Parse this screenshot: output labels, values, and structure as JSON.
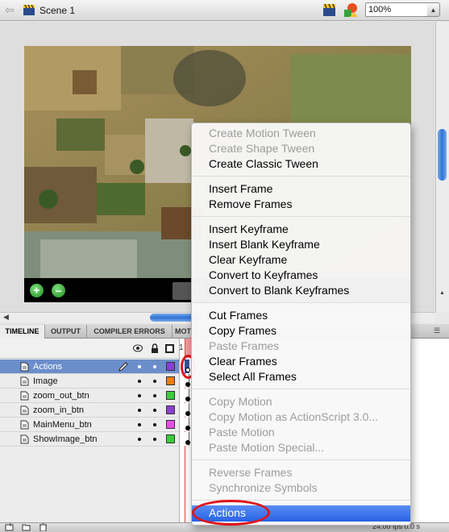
{
  "toolbar": {
    "scene_label": "Scene 1",
    "zoom_value": "100%"
  },
  "timeline": {
    "tabs": [
      "TIMELINE",
      "OUTPUT",
      "COMPILER ERRORS",
      "MOT"
    ],
    "frame_number": "1",
    "layers": [
      {
        "name": "Actions",
        "color": "#8a3fd1",
        "selected": true
      },
      {
        "name": "Image",
        "color": "#f07d14"
      },
      {
        "name": "zoom_out_btn",
        "color": "#3ccd3c"
      },
      {
        "name": "zoom_in_btn",
        "color": "#8a3fd1"
      },
      {
        "name": "MainMenu_btn",
        "color": "#e64fe6"
      },
      {
        "name": "ShowImage_btn",
        "color": "#3ccd3c"
      }
    ],
    "fps": "24.00 fps  0.0 s"
  },
  "context_menu": {
    "groups": [
      [
        {
          "label": "Create Motion Tween",
          "enabled": false
        },
        {
          "label": "Create Shape Tween",
          "enabled": false
        },
        {
          "label": "Create Classic Tween",
          "enabled": true
        }
      ],
      [
        {
          "label": "Insert Frame",
          "enabled": true
        },
        {
          "label": "Remove Frames",
          "enabled": true
        }
      ],
      [
        {
          "label": "Insert Keyframe",
          "enabled": true
        },
        {
          "label": "Insert Blank Keyframe",
          "enabled": true
        },
        {
          "label": "Clear Keyframe",
          "enabled": true
        },
        {
          "label": "Convert to Keyframes",
          "enabled": true
        },
        {
          "label": "Convert to Blank Keyframes",
          "enabled": true
        }
      ],
      [
        {
          "label": "Cut Frames",
          "enabled": true
        },
        {
          "label": "Copy Frames",
          "enabled": true
        },
        {
          "label": "Paste Frames",
          "enabled": false
        },
        {
          "label": "Clear Frames",
          "enabled": true
        },
        {
          "label": "Select All Frames",
          "enabled": true
        }
      ],
      [
        {
          "label": "Copy Motion",
          "enabled": false
        },
        {
          "label": "Copy Motion as ActionScript 3.0...",
          "enabled": false
        },
        {
          "label": "Paste Motion",
          "enabled": false
        },
        {
          "label": "Paste Motion Special...",
          "enabled": false
        }
      ],
      [
        {
          "label": "Reverse Frames",
          "enabled": false
        },
        {
          "label": "Synchronize Symbols",
          "enabled": false
        }
      ],
      [
        {
          "label": "Actions",
          "enabled": true,
          "highlighted": true
        }
      ]
    ]
  }
}
